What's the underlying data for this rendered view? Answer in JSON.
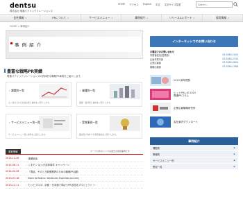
{
  "header": {
    "logo": "dentsu",
    "logo_sub": "株式会社 電通パブリックリレーションズ",
    "links": [
      "HOME",
      "アクセス",
      "English",
      "中文",
      "文字サイズ変更"
    ],
    "search_placeholder": "Search..."
  },
  "gnav": [
    "会社情報",
    "PRについて",
    "サービスメニュー",
    "事例紹介",
    "リリース&レポート",
    "採用情報"
  ],
  "breadcrumb": "HOME  >  事例紹介",
  "banner": {
    "title": "事 例 紹 介"
  },
  "inquiry_button": "インターネットでのお問い合わせ",
  "contacts": [
    {
      "label": "お電話でのお問い合わせ",
      "phone": ""
    },
    {
      "label": "事業者統括(営業部)",
      "phone": "03-5565-1000"
    },
    {
      "label": "企画事業本部",
      "phone": "03-5565-2740"
    },
    {
      "label": "企業広報部",
      "phone": "03-5565-2804"
    },
    {
      "label": "戦略広報部",
      "phone": "03-5565-1566"
    }
  ],
  "promos": [
    {
      "text1": "2015 新年賀詞",
      "text2": ""
    },
    {
      "text1": "ヒットPRレポ 2015",
      "text2": "電通PRコラム"
    },
    {
      "text1": "企業広報戦略研究所",
      "text2": ""
    },
    {
      "text1": "会社案内ダウンロード",
      "text2": ""
    }
  ],
  "section": {
    "title": "豊富な戦略PR実績",
    "desc": "電通パブリックリレーションズの具体的な戦略PR事例をご紹介します。"
  },
  "cards": [
    {
      "label": "課題別一覧",
      "desc": "よく寄せられるお悩み別に事例をご紹介します。"
    },
    {
      "label": "業種別一覧",
      "desc": "業種・業界別に事例をご紹介します。"
    },
    {
      "label": "サービスメニュー別一覧",
      "desc": "サービスメニュー別に事例をご紹介します。"
    },
    {
      "label": "受賞事例一覧",
      "desc": "国内及び海外での受賞事例をご紹介します。"
    }
  ],
  "news": {
    "tab": "更新情報",
    "note": "マーク以外のリンクは過去の受賞事例です",
    "items": [
      {
        "date": "2014.12.26",
        "title": "実績追加"
      },
      {
        "date": "2014.06.11",
        "title": "くまモン はっぴ自体事件 キャンペーン"
      },
      {
        "date": "2014.02.26",
        "title": "「電話、そのとき新聞業界のための戦略PR活動"
      },
      {
        "date": "2013.07.16",
        "title": "Back to Basics: Starbucks Espresso Journey"
      },
      {
        "date": "2013.12.11",
        "title": "もっとクロス！京都・日本酒で学ぼうPR活性化プロジェクト ～"
      }
    ]
  },
  "side_menu": {
    "title": "事例紹介",
    "items": [
      "課題別",
      "業種別",
      "サービスメニュー別",
      "受賞一覧"
    ]
  },
  "colors": {
    "accent_blue": "#3e77b7",
    "accent_red": "#cc0000",
    "nav_dark": "#2b5f9a"
  }
}
